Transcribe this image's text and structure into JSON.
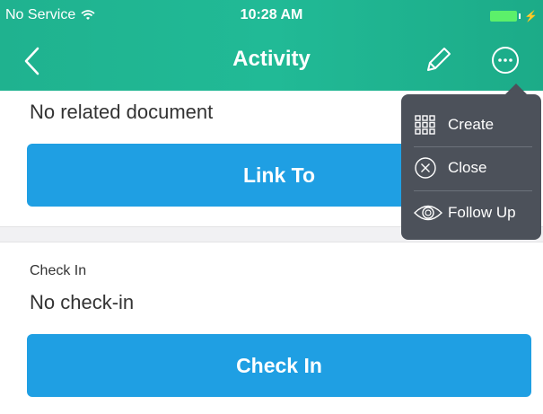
{
  "status_bar": {
    "carrier": "No Service",
    "time": "10:28 AM"
  },
  "nav": {
    "title": "Activity"
  },
  "related_document": {
    "value": "No related document",
    "link_label": "Link To"
  },
  "check_in": {
    "label": "Check In",
    "value": "No check-in",
    "button_label": "Check In"
  },
  "menu": {
    "items": [
      {
        "label": "Create",
        "icon": "grid-icon"
      },
      {
        "label": "Close",
        "icon": "close-circle-icon"
      },
      {
        "label": "Follow Up",
        "icon": "eye-icon"
      }
    ]
  },
  "colors": {
    "header": "#21ba96",
    "primary_button": "#1f9fe3",
    "popover_bg": "#4c515a",
    "battery": "#5cf06a"
  }
}
